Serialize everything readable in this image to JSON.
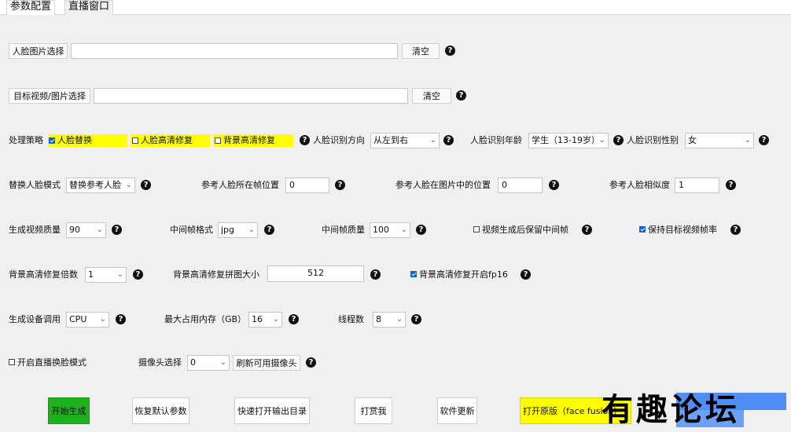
{
  "tabs": [
    {
      "label": "参数配置"
    },
    {
      "label": "直播窗口"
    }
  ],
  "row1": {
    "face_select": "人脸图片选择",
    "clear": "清空",
    "path": ""
  },
  "row2": {
    "target_select": "目标视频/图片选择",
    "clear": "清空",
    "path": ""
  },
  "row3": {
    "strategy_label": "处理策略",
    "opt_swap": "人脸替换",
    "opt_face_enhance": "人脸高清修复",
    "opt_bg_enhance": "背景高清修复",
    "dir_label": "人脸识别方向",
    "dir_value": "从左到右",
    "age_label": "人脸识别年龄",
    "age_value": "学生（13-19岁）",
    "gender_label": "人脸识别性别",
    "gender_value": "女"
  },
  "row4": {
    "mode_label": "替换人脸模式",
    "mode_value": "替换参考人脸",
    "frame_label": "参考人脸所在帧位置",
    "frame_value": "0",
    "pos_label": "参考人脸在图片中的位置",
    "pos_value": "0",
    "sim_label": "参考人脸相似度",
    "sim_value": "1"
  },
  "row5": {
    "quality_label": "生成视频质量",
    "quality_value": "90",
    "fmt_label": "中间帧格式",
    "fmt_value": "jpg",
    "fq_label": "中间帧质量",
    "fq_value": "100",
    "keep_frames": "视频生成后保留中间帧",
    "keep_fps": "保持目标视频帧率"
  },
  "row6": {
    "scale_label": "背景高清修复倍数",
    "scale_value": "1",
    "tile_label": "背景高清修复拼图大小",
    "tile_value": "512",
    "fp16": "背景高清修复开启fp16"
  },
  "row7": {
    "device_label": "生成设备调用",
    "device_value": "CPU",
    "mem_label": "最大占用内存（GB）",
    "mem_value": "16",
    "threads_label": "线程数",
    "threads_value": "8"
  },
  "row8": {
    "live_mode": "开启直播换脸模式",
    "cam_label": "摄像头选择",
    "cam_value": "0",
    "refresh": "刷新可用摄像头"
  },
  "actions": {
    "start": "开始生成",
    "reset": "恢复默认参数",
    "open_out": "快速打开输出目录",
    "tip": "打赏我",
    "update": "软件更新",
    "open_orig": "打开原版（face fusion）"
  },
  "watermark": "有趣论坛",
  "help_glyph": "?",
  "chevron": "⌄",
  "colors": {
    "start_btn": "#1db21d",
    "highlight": "#ffff00",
    "open_orig_btn": "#ffff00",
    "checkbox_on": "#1a5fd6"
  }
}
